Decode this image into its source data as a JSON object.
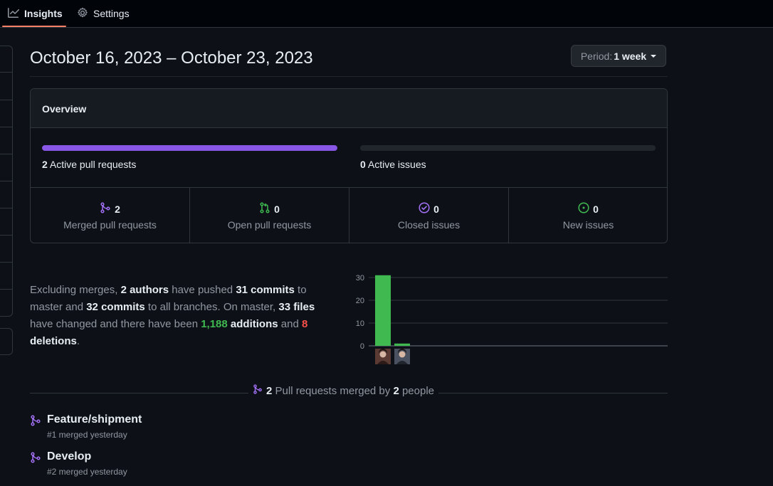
{
  "nav": {
    "insights_label": "Insights",
    "settings_label": "Settings"
  },
  "header": {
    "title": "October 16, 2023 – October 23, 2023",
    "period_prefix": "Period:",
    "period_value": "1 week"
  },
  "overview": {
    "heading": "Overview",
    "active_prs": {
      "count": "2",
      "label": "Active pull requests",
      "fill": 1.0
    },
    "active_issues": {
      "count": "0",
      "label": "Active issues",
      "fill": 0.0
    },
    "stats": [
      {
        "count": "2",
        "label": "Merged pull requests",
        "icon": "merge-icon",
        "color": "#a371f7"
      },
      {
        "count": "0",
        "label": "Open pull requests",
        "icon": "pull-request-icon",
        "color": "#3fb950"
      },
      {
        "count": "0",
        "label": "Closed issues",
        "icon": "issue-closed-icon",
        "color": "#a371f7"
      },
      {
        "count": "0",
        "label": "New issues",
        "icon": "issue-opened-icon",
        "color": "#3fb950"
      }
    ]
  },
  "summary": {
    "t1": "Excluding merges, ",
    "authors": "2 authors",
    "t2": " have pushed ",
    "commits_master": "31 commits",
    "t3": " to master and ",
    "commits_all": "32 commits",
    "t4": " to all branches. On master, ",
    "files": "33 files",
    "t5": " have changed and there have been ",
    "additions_num": "1,188",
    "additions_word": " additions",
    "t6": " and ",
    "deletions_num": "8",
    "deletions_word": " deletions",
    "t7": "."
  },
  "chart_data": {
    "type": "bar",
    "categories": [
      "author-1",
      "author-2"
    ],
    "values": [
      31,
      1
    ],
    "ylim": [
      0,
      30
    ],
    "yticks": [
      "30",
      "20",
      "10",
      "0"
    ],
    "bar_color": "#3fb950",
    "grid": true
  },
  "merged": {
    "count": "2",
    "t1": " Pull requests merged by ",
    "people": "2",
    "t2": " people"
  },
  "pull_requests": [
    {
      "title": "Feature/shipment",
      "meta": "#1 merged yesterday"
    },
    {
      "title": "Develop",
      "meta": "#2 merged yesterday"
    }
  ],
  "colors": {
    "accent": "#f78166",
    "merged": "#a371f7",
    "green": "#3fb950",
    "red": "#f85149",
    "progress": "#8957e5"
  }
}
